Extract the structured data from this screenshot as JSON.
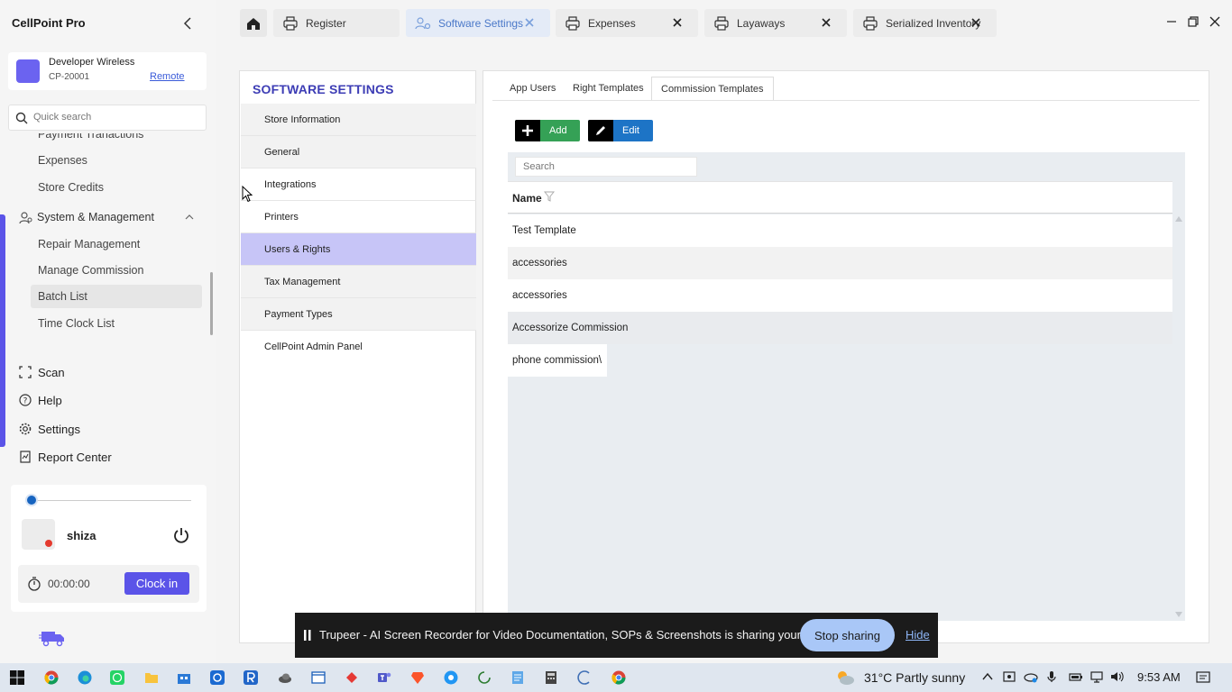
{
  "app": {
    "name": "CellPoint Pro",
    "store_name": "Developer Wireless",
    "store_id": "CP-20001",
    "remote_label": "Remote",
    "accent": "#5b54e8"
  },
  "sidebar": {
    "search_placeholder": "Quick search",
    "items": {
      "payment_transactions": "Payment Tranactions",
      "expenses": "Expenses",
      "store_credits": "Store Credits",
      "system_management": "System & Management",
      "repair_management": "Repair Management",
      "manage_commission": "Manage Commission",
      "batch_list": "Batch List",
      "time_clock_list": "Time Clock List"
    },
    "bottom": {
      "scan": "Scan",
      "help": "Help",
      "settings": "Settings",
      "report_center": "Report Center"
    },
    "user": {
      "name": "shiza",
      "timer": "00:00:00",
      "clock_in_label": "Clock in",
      "status_color": "#e43a2e"
    }
  },
  "tabs": [
    {
      "label": "Register",
      "icon": "printer-icon"
    },
    {
      "label": "Software Settings",
      "icon": "settings-people-icon"
    },
    {
      "label": "Expenses",
      "icon": "printer-icon"
    },
    {
      "label": "Layaways",
      "icon": "printer-icon"
    },
    {
      "label": "Serialized Inventory",
      "icon": "printer-icon"
    }
  ],
  "settings": {
    "title": "SOFTWARE SETTINGS",
    "menu": [
      "Store Information",
      "General",
      "Integrations",
      "Printers",
      "Users & Rights",
      "Tax Management",
      "Payment Types",
      "CellPoint Admin Panel"
    ],
    "selected": "Users & Rights"
  },
  "content": {
    "subtabs": [
      "App Users",
      "Right Templates",
      "Commission Templates"
    ],
    "active_subtab": "Commission Templates",
    "add_label": "Add",
    "edit_label": "Edit",
    "search_placeholder": "Search",
    "column_name": "Name",
    "rows": [
      "Test Template",
      "accessories",
      "accessories",
      "Accessorize Commission",
      "phone commission\\"
    ],
    "add_color": "#35a156",
    "edit_color": "#1d74c6"
  },
  "share_bar": {
    "message": "Trupeer - AI Screen Recorder for Video Documentation, SOPs & Screenshots is sharing your screen.",
    "stop_label": "Stop sharing",
    "hide_label": "Hide"
  },
  "taskbar": {
    "weather": "31°C  Partly sunny",
    "time": "9:53 AM"
  }
}
